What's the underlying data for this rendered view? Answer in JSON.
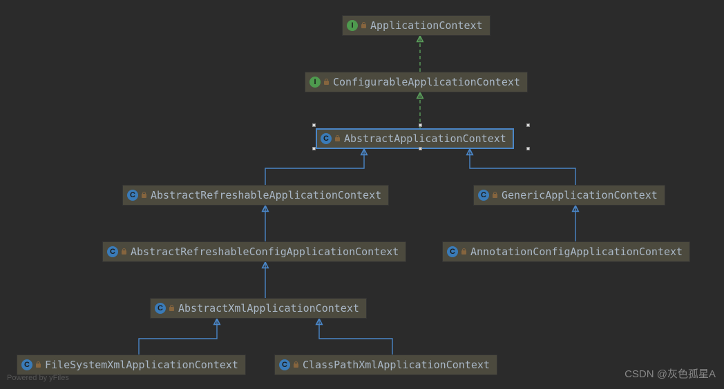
{
  "nodes": {
    "appctx": {
      "label": "ApplicationContext",
      "kind": "interface"
    },
    "cfgctx": {
      "label": "ConfigurableApplicationContext",
      "kind": "interface"
    },
    "absctx": {
      "label": "AbstractApplicationContext",
      "kind": "class"
    },
    "absref": {
      "label": "AbstractRefreshableApplicationContext",
      "kind": "class"
    },
    "genctx": {
      "label": "GenericApplicationContext",
      "kind": "class"
    },
    "abscfg": {
      "label": "AbstractRefreshableConfigApplicationContext",
      "kind": "class"
    },
    "anncfg": {
      "label": "AnnotationConfigApplicationContext",
      "kind": "class"
    },
    "absxml": {
      "label": "AbstractXmlApplicationContext",
      "kind": "class"
    },
    "fsxml": {
      "label": "FileSystemXmlApplicationContext",
      "kind": "class"
    },
    "cpxml": {
      "label": "ClassPathXmlApplicationContext",
      "kind": "class"
    }
  },
  "edges": [
    {
      "from": "cfgctx",
      "to": "appctx",
      "type": "implements"
    },
    {
      "from": "absctx",
      "to": "cfgctx",
      "type": "implements"
    },
    {
      "from": "absref",
      "to": "absctx",
      "type": "extends"
    },
    {
      "from": "genctx",
      "to": "absctx",
      "type": "extends"
    },
    {
      "from": "abscfg",
      "to": "absref",
      "type": "extends"
    },
    {
      "from": "anncfg",
      "to": "genctx",
      "type": "extends"
    },
    {
      "from": "absxml",
      "to": "abscfg",
      "type": "extends"
    },
    {
      "from": "fsxml",
      "to": "absxml",
      "type": "extends"
    },
    {
      "from": "cpxml",
      "to": "absxml",
      "type": "extends"
    }
  ],
  "selected_node": "absctx",
  "colors": {
    "interface_icon": "#4e9a4e",
    "class_icon": "#3a7bb8",
    "extends_line": "#3a7bb8",
    "implements_line": "#4e9a4e",
    "node_bg": "#4c4a3e",
    "canvas_bg": "#2b2b2b",
    "text": "#a9b7c6"
  },
  "watermark_left": "Powered by yFiles",
  "watermark_right": "CSDN @灰色孤星A"
}
